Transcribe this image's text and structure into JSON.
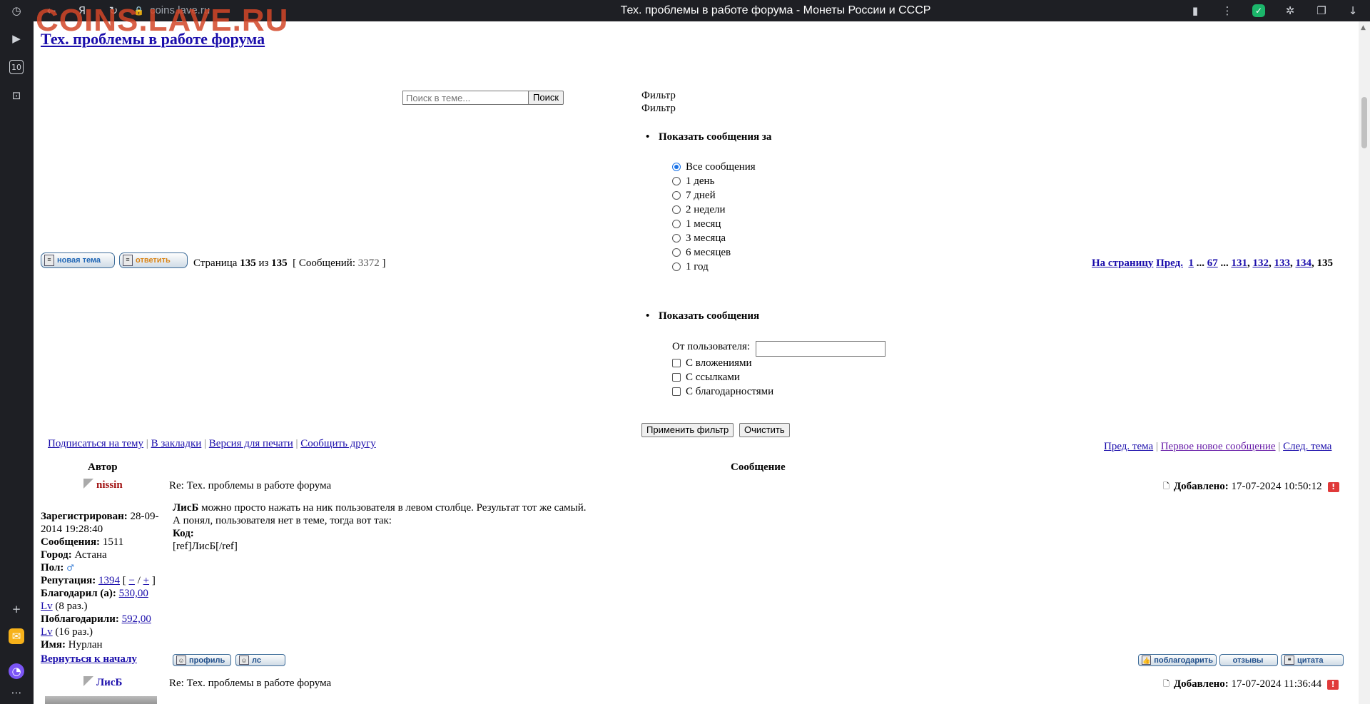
{
  "browser": {
    "url": "coins.lave.ru",
    "tab_title": "Тех. проблемы в работе форума - Монеты России и СССР",
    "watermark": "COINS.LAVE.RU"
  },
  "topic": {
    "title": "Тех. проблемы в работе форума"
  },
  "search": {
    "placeholder": "Поиск в теме...",
    "button": "Поиск"
  },
  "filter": {
    "label1": "Фильтр",
    "label2": "Фильтр",
    "period_heading": "Показать сообщения за",
    "periods": [
      "Все сообщения",
      "1 день",
      "7 дней",
      "2 недели",
      "1 месяц",
      "3 месяца",
      "6 месяцев",
      "1 год"
    ],
    "selected_period": "Все сообщения",
    "show_heading": "Показать сообщения",
    "from_user_label": "От пользователя:",
    "checks": [
      "С вложениями",
      "С ссылками",
      "С благодарностями"
    ],
    "apply": "Применить фильтр",
    "clear": "Очистить"
  },
  "actions": {
    "new_topic": "новая тема",
    "reply": "ответить"
  },
  "pager": {
    "page_word": "Страница",
    "current": "135",
    "of_word": "из",
    "total": "135",
    "messages_label": "[ Сообщений:",
    "messages_count": "3372",
    "messages_close": "]",
    "to_page": "На страницу",
    "prev": "Пред.",
    "pages": [
      "1",
      "67",
      "131",
      "132",
      "133",
      "134"
    ],
    "ellipsis": "...",
    "current_page": "135"
  },
  "topic_links": {
    "subscribe": "Подписаться на тему",
    "bookmarks": "В закладки",
    "print": "Версия для печати",
    "tell_friend": "Сообщить другу",
    "prev_topic": "Пред. тема",
    "first_new": "Первое новое сообщение",
    "next_topic": "След. тема",
    "separator": "|"
  },
  "table": {
    "author_header": "Автор",
    "message_header": "Сообщение"
  },
  "posts": [
    {
      "author": "nissin",
      "subject": "Re: Тех. проблемы в работе форума",
      "added_label": "Добавлено:",
      "date": "17-07-2024 10:50:12",
      "quote_author": "ЛисБ",
      "line1": " можно просто нажать на ник пользователя в левом столбце. Результат тот же самый.",
      "line2": "А понял, пользователя нет в теме, тогда вот так:",
      "code_label": "Код:",
      "code": "[ref]ЛисБ[/ref]",
      "profile": {
        "registered_label": "Зарегистрирован:",
        "registered": "28-09-2014 19:28:40",
        "messages_label": "Сообщения:",
        "messages": "1511",
        "city_label": "Город:",
        "city": "Астана",
        "gender_label": "Пол:",
        "gender_icon": "male-icon",
        "reputation_label": "Репутация:",
        "reputation": "1394",
        "rep_minus": "−",
        "rep_plus": "+",
        "thanked_label": "Благодарил (а):",
        "thanked": "530,00",
        "thanked_unit": "Lv",
        "thanked_times": "(8 раз.)",
        "was_thanked_label": "Поблагодарили:",
        "was_thanked": "592,00",
        "was_thanked_unit": "Lv",
        "was_thanked_times": "(16 раз.)",
        "name_label": "Имя:",
        "name": "Нурлан"
      }
    },
    {
      "author": "ЛисБ",
      "subject": "Re: Тех. проблемы в работе форума",
      "added_label": "Добавлено:",
      "date": "17-07-2024 11:36:44"
    }
  ],
  "post_buttons": {
    "profile": "профиль",
    "pm": "лс",
    "thank": "поблагодарить",
    "reviews": "отзывы",
    "quote": "цитата",
    "back_to_top": "Вернуться к началу"
  }
}
